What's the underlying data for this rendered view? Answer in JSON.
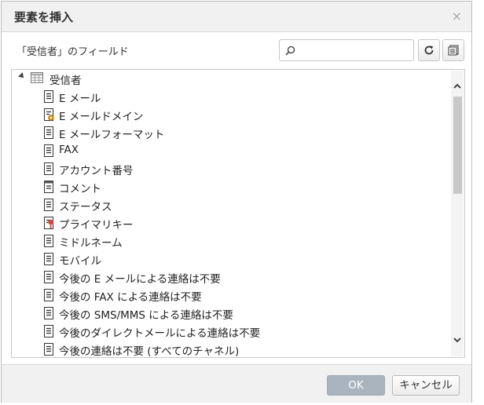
{
  "dialog": {
    "title": "要素を挿入",
    "close_glyph": "×"
  },
  "subtitle": "「受信者」のフィールド",
  "search": {
    "value": "",
    "placeholder": ""
  },
  "tree": {
    "root": {
      "label": "受信者",
      "icon": "table-icon"
    },
    "items": [
      {
        "label": "E メール",
        "icon": "field-icon"
      },
      {
        "label": "E メールドメイン",
        "icon": "computed-field-icon"
      },
      {
        "label": "E メールフォーマット",
        "icon": "field-icon"
      },
      {
        "label": "FAX",
        "icon": "field-icon"
      },
      {
        "label": "アカウント番号",
        "icon": "field-icon"
      },
      {
        "label": "コメント",
        "icon": "memo-field-icon"
      },
      {
        "label": "ステータス",
        "icon": "field-icon"
      },
      {
        "label": "プライマリキー",
        "icon": "primary-key-icon"
      },
      {
        "label": "ミドルネーム",
        "icon": "field-icon"
      },
      {
        "label": "モバイル",
        "icon": "field-icon"
      },
      {
        "label": "今後の E メールによる連絡は不要",
        "icon": "field-icon"
      },
      {
        "label": "今後の FAX による連絡は不要",
        "icon": "field-icon"
      },
      {
        "label": "今後の SMS/MMS による連絡は不要",
        "icon": "field-icon"
      },
      {
        "label": "今後のダイレクトメールによる連絡は不要",
        "icon": "field-icon"
      },
      {
        "label": "今後の連絡は不要 (すべてのチャネル)",
        "icon": "field-icon"
      }
    ]
  },
  "footer": {
    "ok_label": "OK",
    "cancel_label": "キャンセル"
  },
  "colors": {
    "ok_button": "#a9b4be",
    "titlebar": "#f1f1f1",
    "key_red": "#d9463b",
    "gear_orange": "#e3a21a"
  }
}
